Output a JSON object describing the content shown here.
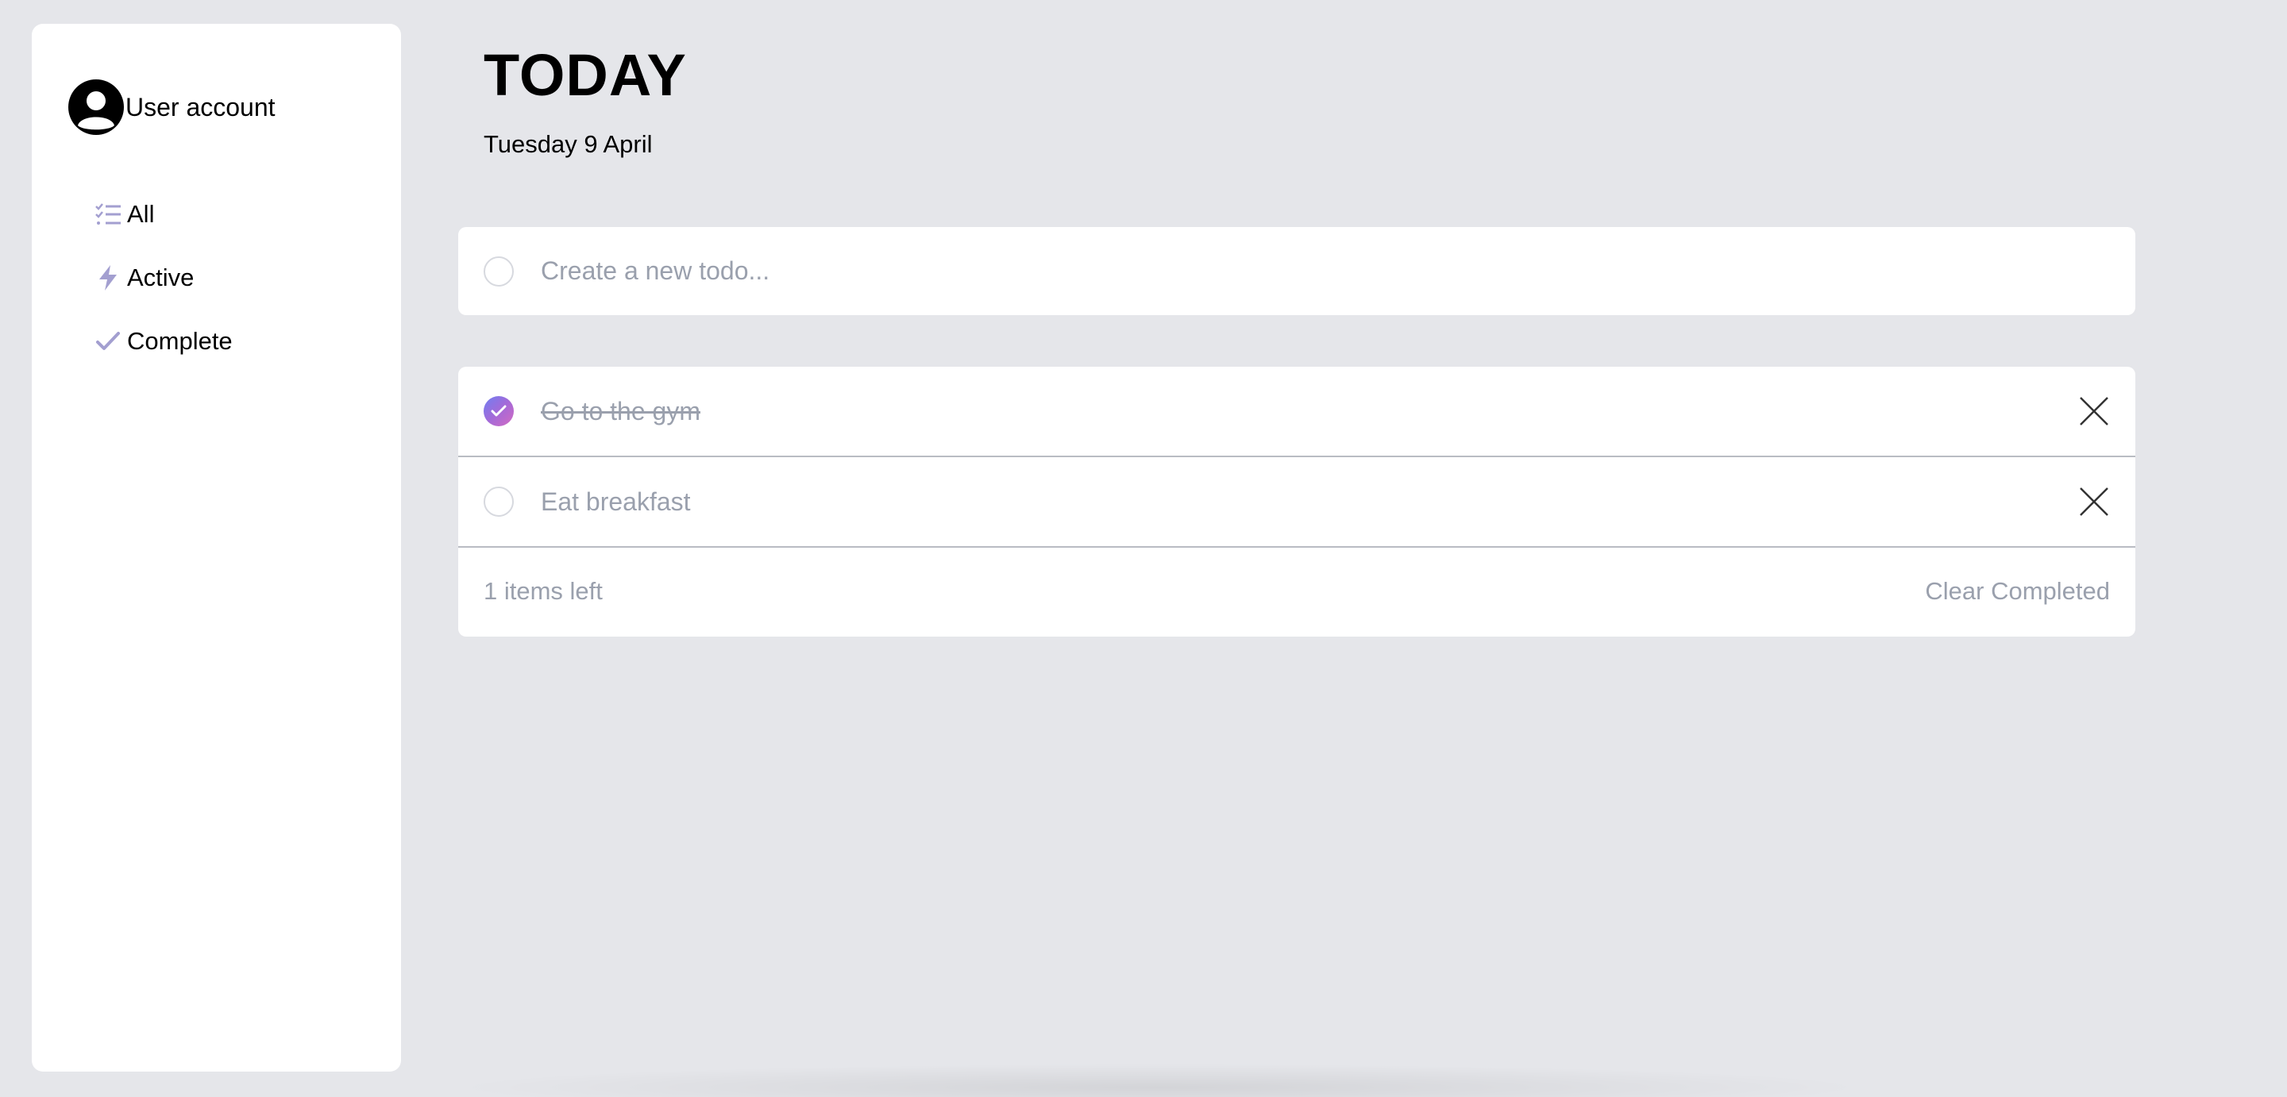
{
  "sidebar": {
    "account_label": "User account",
    "nav": [
      {
        "label": "All",
        "icon": "list-check-icon"
      },
      {
        "label": "Active",
        "icon": "bolt-icon"
      },
      {
        "label": "Complete",
        "icon": "check-icon"
      }
    ]
  },
  "header": {
    "title": "TODAY",
    "date": "Tuesday 9 April"
  },
  "new_todo": {
    "placeholder": "Create a new todo..."
  },
  "todos": [
    {
      "text": "Go to the gym",
      "completed": true
    },
    {
      "text": "Eat breakfast",
      "completed": false
    }
  ],
  "footer": {
    "items_left": "1 items left",
    "clear_label": "Clear Completed"
  },
  "colors": {
    "background": "#e5e6ea",
    "accent_gradient_start": "#6f7ff2",
    "accent_gradient_end": "#d36bc2",
    "nav_icon": "#a39fd0",
    "muted_text": "#9aa0ad"
  }
}
